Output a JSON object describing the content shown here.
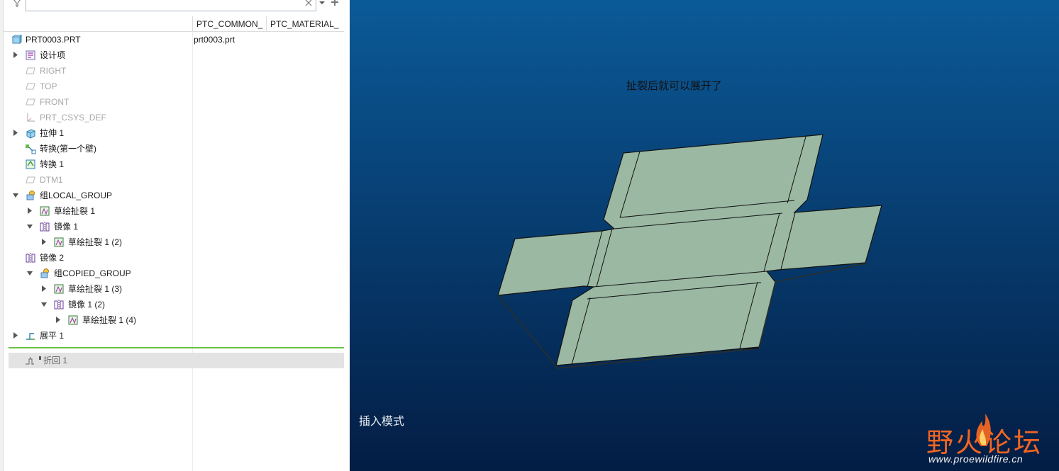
{
  "search": {
    "value": "",
    "clear_icon": "close-icon",
    "filter_icon": "filter-icon"
  },
  "columns": [
    {
      "label": "PTC_COMMON_"
    },
    {
      "label": "PTC_MATERIAL_"
    }
  ],
  "tree": {
    "root": {
      "label": "PRT0003.PRT",
      "common_value": "prt0003.prt",
      "icon": "part-icon"
    },
    "items": [
      {
        "label": "设计项",
        "icon": "design-items-icon",
        "expander": "collapsed",
        "dim": false
      },
      {
        "label": "RIGHT",
        "icon": "datum-plane-icon",
        "expander": "none",
        "dim": true
      },
      {
        "label": "TOP",
        "icon": "datum-plane-icon",
        "expander": "none",
        "dim": true
      },
      {
        "label": "FRONT",
        "icon": "datum-plane-icon",
        "expander": "none",
        "dim": true
      },
      {
        "label": "PRT_CSYS_DEF",
        "icon": "coordinate-system-icon",
        "expander": "none",
        "dim": true
      },
      {
        "label": "拉伸 1",
        "icon": "extrude-icon",
        "expander": "collapsed",
        "dim": false
      },
      {
        "label": "转换(第一个壁)",
        "icon": "convert-first-wall-icon",
        "expander": "none",
        "dim": false
      },
      {
        "label": "转换 1",
        "icon": "convert-icon",
        "expander": "none",
        "dim": false
      },
      {
        "label": "DTM1",
        "icon": "datum-plane-icon",
        "expander": "none",
        "dim": true
      },
      {
        "label": "组LOCAL_GROUP",
        "icon": "group-icon",
        "expander": "expanded",
        "dim": false
      },
      {
        "label": "草绘扯裂 1",
        "icon": "sketched-rip-icon",
        "expander": "collapsed",
        "dim": false
      },
      {
        "label": "镜像 1",
        "icon": "mirror-icon",
        "expander": "expanded",
        "dim": false
      },
      {
        "label": "草绘扯裂 1 (2)",
        "icon": "sketched-rip-icon",
        "expander": "collapsed",
        "dim": false
      },
      {
        "label": "镜像 2",
        "icon": "mirror-icon",
        "expander": "none",
        "dim": false
      },
      {
        "label": "组COPIED_GROUP",
        "icon": "group-icon",
        "expander": "expanded",
        "dim": false
      },
      {
        "label": "草绘扯裂 1 (3)",
        "icon": "sketched-rip-icon",
        "expander": "collapsed",
        "dim": false
      },
      {
        "label": "镜像 1 (2)",
        "icon": "mirror-icon",
        "expander": "expanded",
        "dim": false
      },
      {
        "label": "草绘扯裂 1 (4)",
        "icon": "sketched-rip-icon",
        "expander": "collapsed",
        "dim": false
      },
      {
        "label": "展平 1",
        "icon": "unbend-icon",
        "expander": "collapsed",
        "dim": false
      }
    ],
    "suppressed": {
      "label": "折回 1",
      "icon": "bend-back-icon"
    }
  },
  "viewport": {
    "note": "扯裂后就可以展开了",
    "mode_label": "插入模式",
    "model_face_color": "#9ab8a2",
    "edge_color": "#111111",
    "background_top": "#0b5a98",
    "background_bottom": "#031d44"
  },
  "watermark": {
    "text": "野火论坛",
    "url": "www.proewildfire.cn",
    "text_color": "#f26522"
  },
  "colors": {
    "insert_line": "#6cc04a",
    "suppressed_row_bg": "#e3e3e3"
  }
}
